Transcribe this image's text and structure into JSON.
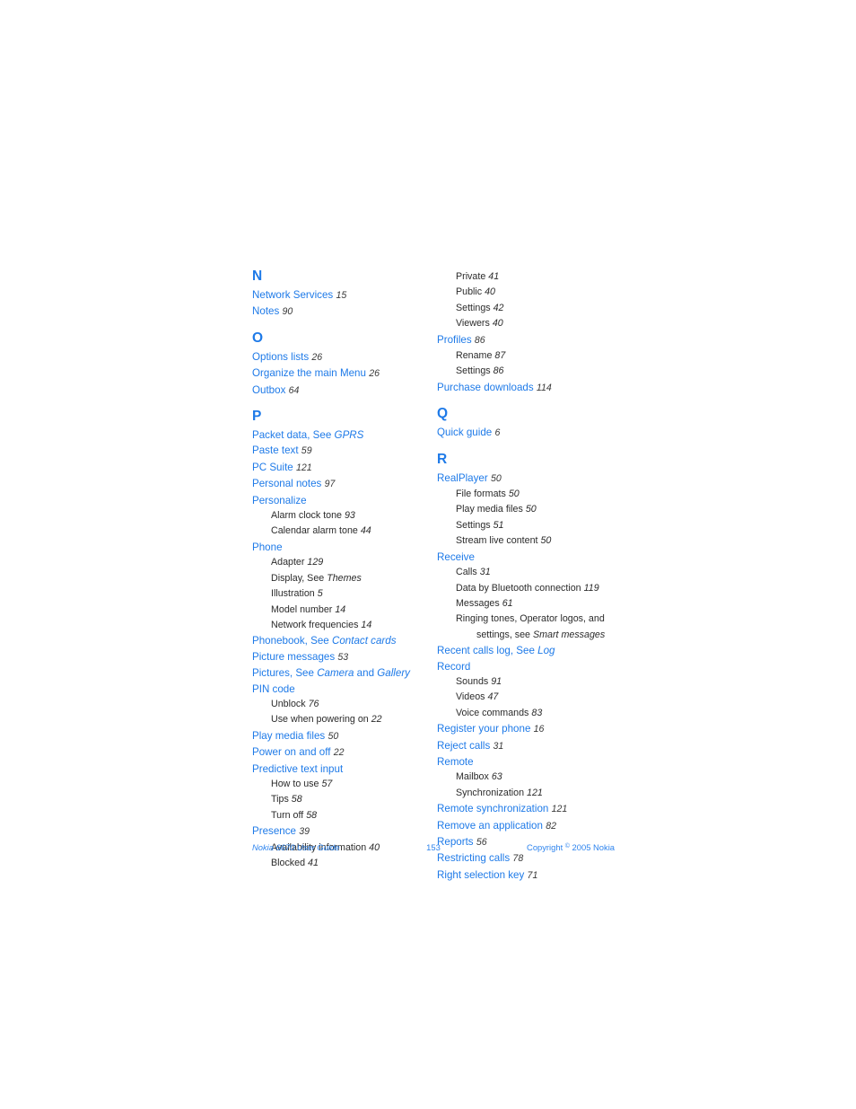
{
  "document": {
    "page_number": "153",
    "footer_left": "Nokia 6670 User Guide",
    "footer_right_prefix": "Copyright ",
    "footer_right_symbol": "©",
    "footer_right_suffix": " 2005 Nokia"
  },
  "colors": {
    "heading_blue": "#1e7ae8",
    "entry_blue": "#1e7ae8",
    "sub_black": "#2b2b2b",
    "page_num_gray": "#3a3a3a",
    "footer_blue": "#2e84ee",
    "background": "#ffffff"
  },
  "left_column": {
    "blocks": [
      {
        "letter": "N",
        "lines": [
          {
            "type": "entry",
            "parts": [
              {
                "t": "Network Services",
                "s": "n"
              },
              {
                "t": "15",
                "s": "pg"
              }
            ]
          },
          {
            "type": "entry",
            "parts": [
              {
                "t": "Notes",
                "s": "n"
              },
              {
                "t": "90",
                "s": "pg"
              }
            ]
          }
        ]
      },
      {
        "letter": "O",
        "lines": [
          {
            "type": "entry",
            "parts": [
              {
                "t": "Options lists",
                "s": "n"
              },
              {
                "t": "26",
                "s": "pg"
              }
            ]
          },
          {
            "type": "entry",
            "parts": [
              {
                "t": "Organize the main Menu",
                "s": "n"
              },
              {
                "t": "26",
                "s": "pg"
              }
            ]
          },
          {
            "type": "entry",
            "parts": [
              {
                "t": "Outbox",
                "s": "n"
              },
              {
                "t": "64",
                "s": "pg"
              }
            ]
          }
        ]
      },
      {
        "letter": "P",
        "lines": [
          {
            "type": "entry",
            "parts": [
              {
                "t": "Packet data, See",
                "s": "n"
              },
              {
                "t": "GPRS",
                "s": "it"
              }
            ]
          },
          {
            "type": "entry",
            "parts": [
              {
                "t": "Paste text",
                "s": "n"
              },
              {
                "t": "59",
                "s": "pg"
              }
            ]
          },
          {
            "type": "entry",
            "parts": [
              {
                "t": "PC Suite",
                "s": "n"
              },
              {
                "t": "121",
                "s": "pg"
              }
            ]
          },
          {
            "type": "entry",
            "parts": [
              {
                "t": "Personal notes",
                "s": "n"
              },
              {
                "t": "97",
                "s": "pg"
              }
            ]
          },
          {
            "type": "entry",
            "parts": [
              {
                "t": "Personalize",
                "s": "n"
              }
            ]
          },
          {
            "type": "sub",
            "parts": [
              {
                "t": "Alarm clock tone",
                "s": "n"
              },
              {
                "t": "93",
                "s": "pg"
              }
            ]
          },
          {
            "type": "sub",
            "parts": [
              {
                "t": "Calendar alarm tone",
                "s": "n"
              },
              {
                "t": "44",
                "s": "pg"
              }
            ]
          },
          {
            "type": "entry",
            "parts": [
              {
                "t": "Phone",
                "s": "n"
              }
            ]
          },
          {
            "type": "sub",
            "parts": [
              {
                "t": "Adapter",
                "s": "n"
              },
              {
                "t": "129",
                "s": "pg"
              }
            ]
          },
          {
            "type": "sub",
            "parts": [
              {
                "t": "Display, See",
                "s": "n"
              },
              {
                "t": "Themes",
                "s": "it"
              }
            ]
          },
          {
            "type": "sub",
            "parts": [
              {
                "t": "Illustration",
                "s": "n"
              },
              {
                "t": "5",
                "s": "pg"
              }
            ]
          },
          {
            "type": "sub",
            "parts": [
              {
                "t": "Model number",
                "s": "n"
              },
              {
                "t": "14",
                "s": "pg"
              }
            ]
          },
          {
            "type": "sub",
            "parts": [
              {
                "t": "Network frequencies",
                "s": "n"
              },
              {
                "t": "14",
                "s": "pg"
              }
            ]
          },
          {
            "type": "entry",
            "parts": [
              {
                "t": "Phonebook, See",
                "s": "n"
              },
              {
                "t": "Contact cards",
                "s": "it"
              }
            ]
          },
          {
            "type": "entry",
            "parts": [
              {
                "t": "Picture messages",
                "s": "n"
              },
              {
                "t": "53",
                "s": "pg"
              }
            ]
          },
          {
            "type": "entry",
            "parts": [
              {
                "t": "Pictures, See",
                "s": "n"
              },
              {
                "t": "Camera",
                "s": "it"
              },
              {
                "t": "and",
                "s": "n"
              },
              {
                "t": "Gallery",
                "s": "it"
              }
            ]
          },
          {
            "type": "entry",
            "parts": [
              {
                "t": "PIN code",
                "s": "n"
              }
            ]
          },
          {
            "type": "sub",
            "parts": [
              {
                "t": "Unblock",
                "s": "n"
              },
              {
                "t": "76",
                "s": "pg"
              }
            ]
          },
          {
            "type": "sub",
            "parts": [
              {
                "t": "Use when powering on",
                "s": "n"
              },
              {
                "t": "22",
                "s": "pg"
              }
            ]
          },
          {
            "type": "entry",
            "parts": [
              {
                "t": "Play media files",
                "s": "n"
              },
              {
                "t": "50",
                "s": "pg"
              }
            ]
          },
          {
            "type": "entry",
            "parts": [
              {
                "t": "Power on and off",
                "s": "n"
              },
              {
                "t": "22",
                "s": "pg"
              }
            ]
          },
          {
            "type": "entry",
            "parts": [
              {
                "t": "Predictive text input",
                "s": "n"
              }
            ]
          },
          {
            "type": "sub",
            "parts": [
              {
                "t": "How to use",
                "s": "n"
              },
              {
                "t": "57",
                "s": "pg"
              }
            ]
          },
          {
            "type": "sub",
            "parts": [
              {
                "t": "Tips",
                "s": "n"
              },
              {
                "t": "58",
                "s": "pg"
              }
            ]
          },
          {
            "type": "sub",
            "parts": [
              {
                "t": "Turn off",
                "s": "n"
              },
              {
                "t": "58",
                "s": "pg"
              }
            ]
          },
          {
            "type": "entry",
            "parts": [
              {
                "t": "Presence",
                "s": "n"
              },
              {
                "t": "39",
                "s": "pg"
              }
            ]
          },
          {
            "type": "sub",
            "parts": [
              {
                "t": "Availability information",
                "s": "n"
              },
              {
                "t": "40",
                "s": "pg"
              }
            ]
          },
          {
            "type": "sub",
            "parts": [
              {
                "t": "Blocked",
                "s": "n"
              },
              {
                "t": "41",
                "s": "pg"
              }
            ]
          }
        ]
      }
    ]
  },
  "right_column": {
    "blocks": [
      {
        "letter": null,
        "lines": [
          {
            "type": "sub",
            "parts": [
              {
                "t": "Private",
                "s": "n"
              },
              {
                "t": "41",
                "s": "pg"
              }
            ]
          },
          {
            "type": "sub",
            "parts": [
              {
                "t": "Public",
                "s": "n"
              },
              {
                "t": "40",
                "s": "pg"
              }
            ]
          },
          {
            "type": "sub",
            "parts": [
              {
                "t": "Settings",
                "s": "n"
              },
              {
                "t": "42",
                "s": "pg"
              }
            ]
          },
          {
            "type": "sub",
            "parts": [
              {
                "t": "Viewers",
                "s": "n"
              },
              {
                "t": "40",
                "s": "pg"
              }
            ]
          },
          {
            "type": "entry",
            "parts": [
              {
                "t": "Profiles",
                "s": "n"
              },
              {
                "t": "86",
                "s": "pg"
              }
            ]
          },
          {
            "type": "sub",
            "parts": [
              {
                "t": "Rename",
                "s": "n"
              },
              {
                "t": "87",
                "s": "pg"
              }
            ]
          },
          {
            "type": "sub",
            "parts": [
              {
                "t": "Settings",
                "s": "n"
              },
              {
                "t": "86",
                "s": "pg"
              }
            ]
          },
          {
            "type": "entry",
            "parts": [
              {
                "t": "Purchase downloads",
                "s": "n"
              },
              {
                "t": "114",
                "s": "pg"
              }
            ]
          }
        ]
      },
      {
        "letter": "Q",
        "lines": [
          {
            "type": "entry",
            "parts": [
              {
                "t": "Quick guide",
                "s": "n"
              },
              {
                "t": "6",
                "s": "pg"
              }
            ]
          }
        ]
      },
      {
        "letter": "R",
        "lines": [
          {
            "type": "entry",
            "parts": [
              {
                "t": "RealPlayer",
                "s": "n"
              },
              {
                "t": "50",
                "s": "pg"
              }
            ]
          },
          {
            "type": "sub",
            "parts": [
              {
                "t": "File formats",
                "s": "n"
              },
              {
                "t": "50",
                "s": "pg"
              }
            ]
          },
          {
            "type": "sub",
            "parts": [
              {
                "t": "Play media files",
                "s": "n"
              },
              {
                "t": "50",
                "s": "pg"
              }
            ]
          },
          {
            "type": "sub",
            "parts": [
              {
                "t": "Settings",
                "s": "n"
              },
              {
                "t": "51",
                "s": "pg"
              }
            ]
          },
          {
            "type": "sub",
            "parts": [
              {
                "t": "Stream live content",
                "s": "n"
              },
              {
                "t": "50",
                "s": "pg"
              }
            ]
          },
          {
            "type": "entry",
            "parts": [
              {
                "t": "Receive",
                "s": "n"
              }
            ]
          },
          {
            "type": "sub",
            "parts": [
              {
                "t": "Calls",
                "s": "n"
              },
              {
                "t": "31",
                "s": "pg"
              }
            ]
          },
          {
            "type": "sub",
            "parts": [
              {
                "t": "Data by Bluetooth connection",
                "s": "n"
              },
              {
                "t": "119",
                "s": "pg"
              }
            ]
          },
          {
            "type": "sub",
            "parts": [
              {
                "t": "Messages",
                "s": "n"
              },
              {
                "t": "61",
                "s": "pg"
              }
            ]
          },
          {
            "type": "sub2",
            "parts": [
              {
                "t": "Ringing tones, Operator logos, and",
                "s": "n"
              }
            ],
            "line2": [
              {
                "t": "settings, see",
                "s": "n"
              },
              {
                "t": "Smart messages",
                "s": "it"
              }
            ]
          },
          {
            "type": "entry",
            "parts": [
              {
                "t": "Recent calls log, See",
                "s": "n"
              },
              {
                "t": "Log",
                "s": "it"
              }
            ]
          },
          {
            "type": "entry",
            "parts": [
              {
                "t": "Record",
                "s": "n"
              }
            ]
          },
          {
            "type": "sub",
            "parts": [
              {
                "t": "Sounds",
                "s": "n"
              },
              {
                "t": "91",
                "s": "pg"
              }
            ]
          },
          {
            "type": "sub",
            "parts": [
              {
                "t": "Videos",
                "s": "n"
              },
              {
                "t": "47",
                "s": "pg"
              }
            ]
          },
          {
            "type": "sub",
            "parts": [
              {
                "t": "Voice commands",
                "s": "n"
              },
              {
                "t": "83",
                "s": "pg"
              }
            ]
          },
          {
            "type": "entry",
            "parts": [
              {
                "t": "Register your phone",
                "s": "n"
              },
              {
                "t": "16",
                "s": "pg"
              }
            ]
          },
          {
            "type": "entry",
            "parts": [
              {
                "t": "Reject calls",
                "s": "n"
              },
              {
                "t": "31",
                "s": "pg"
              }
            ]
          },
          {
            "type": "entry",
            "parts": [
              {
                "t": "Remote",
                "s": "n"
              }
            ]
          },
          {
            "type": "sub",
            "parts": [
              {
                "t": "Mailbox",
                "s": "n"
              },
              {
                "t": "63",
                "s": "pg"
              }
            ]
          },
          {
            "type": "sub",
            "parts": [
              {
                "t": "Synchronization",
                "s": "n"
              },
              {
                "t": "121",
                "s": "pg"
              }
            ]
          },
          {
            "type": "entry",
            "parts": [
              {
                "t": "Remote synchronization",
                "s": "n"
              },
              {
                "t": "121",
                "s": "pg"
              }
            ]
          },
          {
            "type": "entry",
            "parts": [
              {
                "t": "Remove an application",
                "s": "n"
              },
              {
                "t": "82",
                "s": "pg"
              }
            ]
          },
          {
            "type": "entry",
            "parts": [
              {
                "t": "Reports",
                "s": "n"
              },
              {
                "t": "56",
                "s": "pg"
              }
            ]
          },
          {
            "type": "entry",
            "parts": [
              {
                "t": "Restricting calls",
                "s": "n"
              },
              {
                "t": "78",
                "s": "pg"
              }
            ]
          },
          {
            "type": "entry",
            "parts": [
              {
                "t": "Right selection key",
                "s": "n"
              },
              {
                "t": "71",
                "s": "pg"
              }
            ]
          }
        ]
      }
    ]
  }
}
